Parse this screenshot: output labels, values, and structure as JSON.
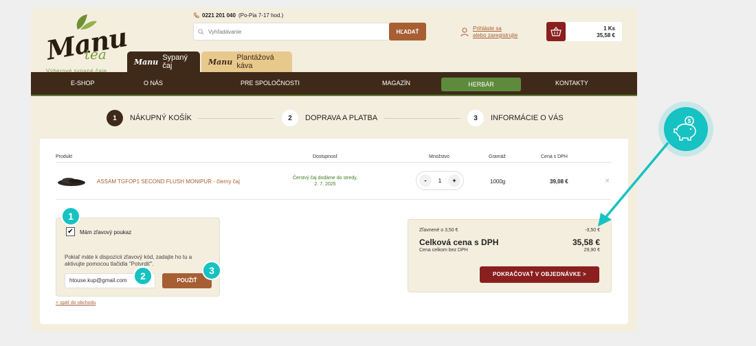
{
  "header": {
    "logo_brand": "Manu",
    "logo_sub": "tea",
    "logo_tagline": "Výberové sypané čaje",
    "phone_number": "0221 201 040",
    "phone_hours": "(Po-Pia 7-17 hod.)",
    "search_placeholder": "Vyhľadávanie",
    "search_button": "HĽADAŤ",
    "login_line1": "Prihláste sa",
    "login_line2": "alebo zaregistrujte",
    "cart_count": "1 Ks",
    "cart_total": "35,58 €"
  },
  "tabs": [
    {
      "brand": "Manu",
      "label": "Sypaný čaj"
    },
    {
      "brand": "Manu",
      "label": "Plantážová káva"
    }
  ],
  "nav": {
    "items": [
      "E-SHOP",
      "O NÁS",
      "PRE SPOLOČNOSTI",
      "MAGAZÍN",
      "HERBÁR",
      "KONTAKTY"
    ],
    "active": "HERBÁR"
  },
  "steps": [
    {
      "num": "1",
      "label": "NÁKUPNÝ KOŠÍK"
    },
    {
      "num": "2",
      "label": "DOPRAVA A PLATBA"
    },
    {
      "num": "3",
      "label": "INFORMÁCIE O VÁS"
    }
  ],
  "table": {
    "headers": [
      "Produkt",
      "Dostupnosť",
      "Množstvo",
      "Gramáž",
      "Cena s DPH"
    ],
    "row": {
      "name": "ASSAM TGFOP1 SECOND FLUSH MONIPUR - čierny čaj",
      "availability_line1": "Čerstvý čaj dodáme do stredy,",
      "availability_line2": "2. 7. 2025",
      "quantity": "1",
      "minus": "-",
      "plus": "+",
      "weight": "1000g",
      "price": "39,08 €",
      "remove": "×"
    }
  },
  "voucher": {
    "checkbox_label": "Mám zľavový poukaz",
    "checkmark": "✔",
    "info": "Pokiaľ máte k dispozícii zľavový kód, zadajte ho tu a aktivujte pomocou tlačidla \"Potvrdiť\".",
    "input_value": "htouse.kup@gmail.com",
    "apply_button": "POUŽIŤ"
  },
  "back_link": "< späť do obchodu",
  "summary": {
    "discount_label": "Zľavnené o 3,50 €",
    "discount_value": "-3,50 €",
    "total_label": "Celková cena s DPH",
    "total_value": "35,58 €",
    "net_label": "Cena celkom bez DPH",
    "net_value": "29,90 €",
    "continue_button": "POKRAČOVAŤ V OBJEDNÁVKE  >"
  },
  "annotations": [
    "1",
    "2",
    "3"
  ],
  "colors": {
    "accent": "#16c2c2",
    "brown": "#3f2a1a",
    "button": "#a75e32",
    "continue": "#8a1f1f",
    "green": "#5e8a3c"
  }
}
